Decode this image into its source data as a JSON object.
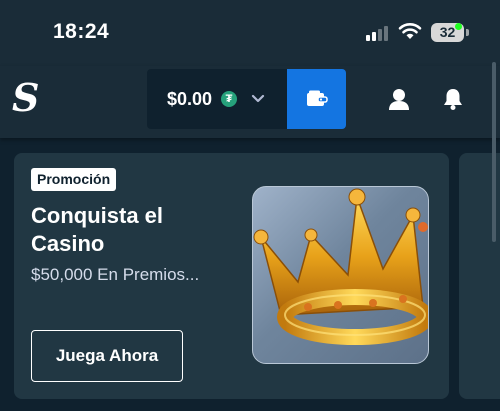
{
  "status_bar": {
    "time": "18:24",
    "battery": "32"
  },
  "header": {
    "logo": "S",
    "balance": "$0.00",
    "currency_symbol": "₮"
  },
  "promo": {
    "badge": "Promoción",
    "title": "Conquista el Casino",
    "subtitle": "$50,000 En Premios...",
    "cta": "Juega Ahora"
  },
  "colors": {
    "background": "#0f212e",
    "header": "#1a2c38",
    "card": "#213743",
    "wallet_button": "#1475e1",
    "notification_dot": "#1fff20",
    "tether_green": "#26a17b"
  },
  "icons": [
    "signal-icon",
    "wifi-icon",
    "battery-icon",
    "tether-coin-icon",
    "chevron-down-icon",
    "wallet-icon",
    "user-icon",
    "bell-icon",
    "crown-icon"
  ]
}
